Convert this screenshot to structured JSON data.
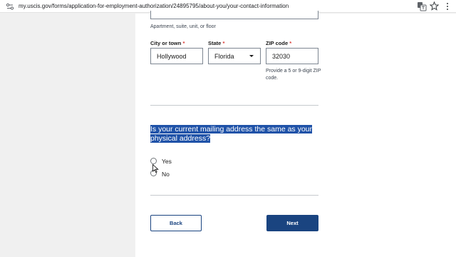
{
  "browser": {
    "url": "my.uscis.gov/forms/application-for-employment-authorization/24895795/about-you/your-contact-information"
  },
  "form": {
    "address_hint": "Apartment, suite, unit, or floor",
    "city": {
      "label": "City or town",
      "value": "Hollywood"
    },
    "state": {
      "label": "State",
      "value": "Florida"
    },
    "zip": {
      "label": "ZIP code",
      "value": "32030",
      "hint": "Provide a 5 or 9-digit ZIP code."
    },
    "required_marker": "*",
    "question": "Is your current mailing address the same as your physical address?",
    "options": [
      {
        "label": "Yes",
        "selected": false
      },
      {
        "label": "No",
        "selected": false
      }
    ],
    "back_label": "Back",
    "next_label": "Next"
  },
  "colors": {
    "primary": "#1a4480",
    "highlight": "#1f52a8",
    "required": "#d83933"
  }
}
